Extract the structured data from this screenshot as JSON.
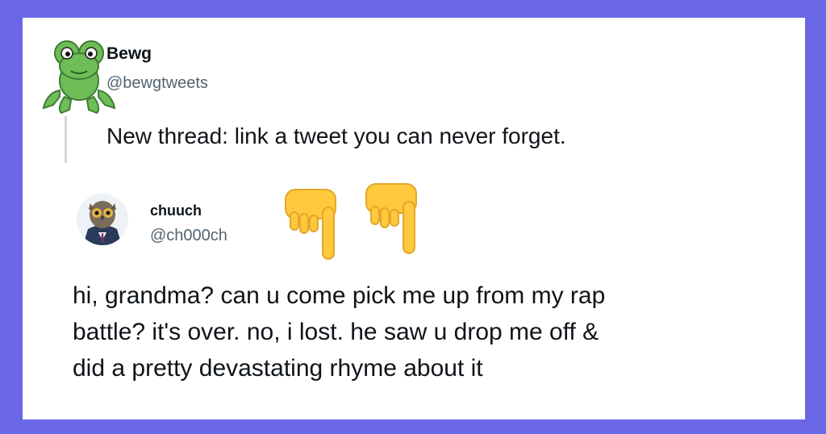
{
  "thread": {
    "author": {
      "name": "Bewg",
      "handle": "@bewgtweets"
    },
    "text": "New thread: link a tweet you can never forget."
  },
  "reply": {
    "author": {
      "name": "chuuch",
      "handle": "@ch000ch"
    },
    "lines": [
      "hi, grandma? can u come pick me up from my rap",
      "battle? it's over. no, i lost. he saw u drop me off &",
      "did a pretty devastating rhyme about it"
    ]
  },
  "icons": {
    "frog": "frog-avatar-icon",
    "owl": "owl-avatar-icon",
    "pointer": "pointing-down-hand-icon"
  },
  "colors": {
    "frame": "#6a67e6",
    "card": "#ffffff",
    "text": "#0f1419",
    "muted": "#536471",
    "frog": "#6fbd57",
    "hand": "#ffc83d"
  }
}
